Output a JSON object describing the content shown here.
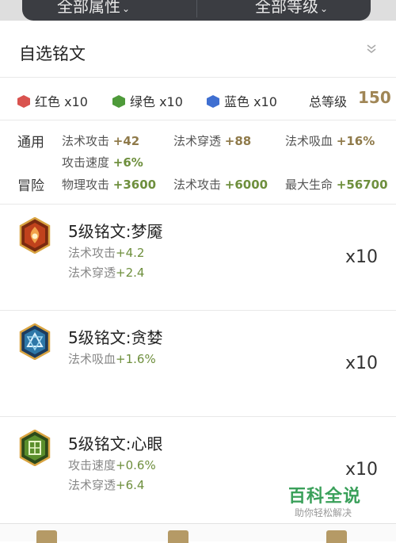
{
  "filters": {
    "attribute": "全部属性",
    "level": "全部等级",
    "chevron": "⌄"
  },
  "header": {
    "title": "自选铭文"
  },
  "colors": {
    "red": {
      "label": "红色 x10",
      "color": "#d9534f"
    },
    "green": {
      "label": "绿色 x10",
      "color": "#4e9a3a"
    },
    "blue": {
      "label": "蓝色 x10",
      "color": "#3f6fd1"
    },
    "total_label": "总等级",
    "total_value": "150"
  },
  "stats": {
    "general": {
      "label": "通用",
      "items": [
        {
          "name": "法术攻击",
          "value": "+42"
        },
        {
          "name": "法术穿透",
          "value": "+88"
        },
        {
          "name": "法术吸血",
          "value": "+16%"
        },
        {
          "name": "攻击速度",
          "value": "+6%"
        }
      ]
    },
    "adventure": {
      "label": "冒险",
      "items": [
        {
          "name": "物理攻击",
          "value": "+3600"
        },
        {
          "name": "法术攻击",
          "value": "+6000"
        },
        {
          "name": "最大生命",
          "value": "+56700"
        }
      ]
    }
  },
  "inscriptions": [
    {
      "name": "5级铭文:梦魇",
      "icon": "red-inscription-icon",
      "attrs": [
        {
          "name": "法术攻击",
          "value": "+4.2"
        },
        {
          "name": "法术穿透",
          "value": "+2.4"
        }
      ],
      "qty": "x10"
    },
    {
      "name": "5级铭文:贪婪",
      "icon": "blue-inscription-icon",
      "attrs": [
        {
          "name": "法术吸血",
          "value": "+1.6%"
        }
      ],
      "qty": "x10"
    },
    {
      "name": "5级铭文:心眼",
      "icon": "green-inscription-icon",
      "attrs": [
        {
          "name": "攻击速度",
          "value": "+0.6%"
        },
        {
          "name": "法术穿透",
          "value": "+6.4"
        }
      ],
      "qty": "x10"
    }
  ],
  "watermark": {
    "title": "百科全说",
    "subtitle": "助你轻松解决"
  }
}
